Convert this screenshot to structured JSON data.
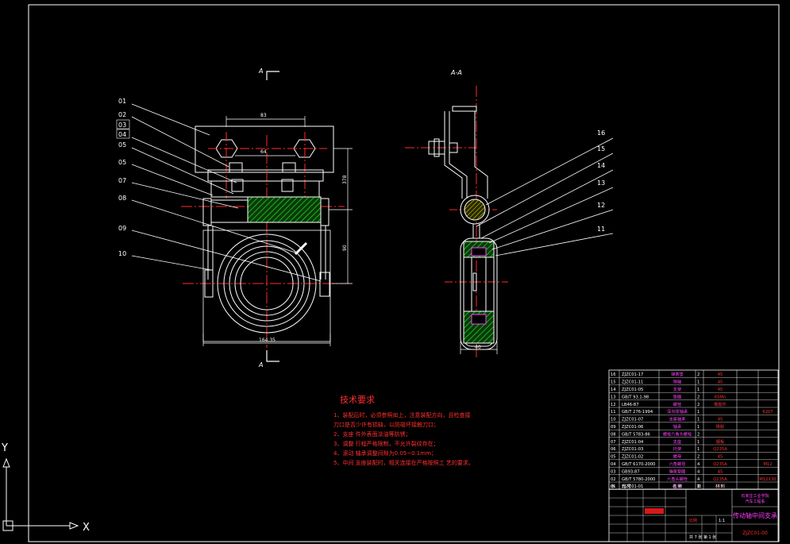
{
  "view_labels": {
    "section_marker_top": "A",
    "section_marker_bottom": "A",
    "section_view_title": "A-A"
  },
  "front_view": {
    "part_labels": [
      "01",
      "02",
      "03",
      "04",
      "05",
      "05",
      "07",
      "08",
      "09",
      "10"
    ],
    "dim_top": "83",
    "dim_inner": "64",
    "dim_height": "378",
    "dim_mid": "90",
    "dim_bottom": "164.35"
  },
  "side_view": {
    "part_labels": [
      "16",
      "15",
      "14",
      "13",
      "12",
      "11"
    ],
    "dim_width": "40"
  },
  "technical_requirements": {
    "title": "技术要求",
    "items": [
      "1、装配后时，必须参照如上，注意装配方向，且检查接",
      "刀口是否少许有损缺，以防碰坏接触刀口；",
      "2、支座 件外表面涂油等防锈；",
      "3、调整 行程严格限制，不允许裂纹存在；",
      "4、滚动 轴承调整间隙为0.05~0.1mm；",
      "5、中间 支座装配时，相关连接在严格按照工 艺的要求。"
    ]
  },
  "bom": {
    "rows": [
      {
        "no": "16",
        "code": "ZJZC01-17",
        "name": "弹簧垫",
        "qty": "2",
        "mat": "45",
        "note": ""
      },
      {
        "no": "15",
        "code": "ZJZC01-11",
        "name": "销轴",
        "qty": "1",
        "mat": "45",
        "note": ""
      },
      {
        "no": "14",
        "code": "ZJZC01-05",
        "name": "支架",
        "qty": "1",
        "mat": "45",
        "note": ""
      },
      {
        "no": "13",
        "code": "GB/T 93.1-98",
        "name": "垫圈",
        "qty": "2",
        "mat": "65Mn",
        "note": ""
      },
      {
        "no": "12",
        "code": "LB46-87",
        "name": "螺栓",
        "qty": "2",
        "mat": "橡胶件",
        "note": ""
      },
      {
        "no": "11",
        "code": "GB/T 276-1994",
        "name": "深沟球轴承",
        "qty": "1",
        "mat": "",
        "note": "6207"
      },
      {
        "no": "10",
        "code": "ZJZC01-07",
        "name": "支座轴承",
        "qty": "1",
        "mat": "45",
        "note": ""
      },
      {
        "no": "09",
        "code": "ZJZC01-06",
        "name": "轴承",
        "qty": "1",
        "mat": "橡胶",
        "note": ""
      },
      {
        "no": "08",
        "code": "GB/T 5783-86",
        "name": "螺栓六角头螺栓",
        "qty": "2",
        "mat": "",
        "note": ""
      },
      {
        "no": "07",
        "code": "ZJZC01-04",
        "name": "支座",
        "qty": "1",
        "mat": "钢板",
        "note": ""
      },
      {
        "no": "06",
        "code": "ZJZC01-03",
        "name": "托架",
        "qty": "1",
        "mat": "Q235A",
        "note": ""
      },
      {
        "no": "05",
        "code": "ZJZC01-02",
        "name": "螺母",
        "qty": "2",
        "mat": "45",
        "note": ""
      },
      {
        "no": "04",
        "code": "GB/T 6170-2000",
        "name": "六角螺母",
        "qty": "4",
        "mat": "Q235A",
        "note": "M12"
      },
      {
        "no": "03",
        "code": "GB93-87",
        "name": "弹簧垫圈",
        "qty": "4",
        "mat": "45",
        "note": ""
      },
      {
        "no": "02",
        "code": "GB/T 5780-2000",
        "name": "六角头螺栓",
        "qty": "4",
        "mat": "Q235A",
        "note": "M12X30"
      },
      {
        "no": "01",
        "code": "ZJZC01-01",
        "name": "支架",
        "qty": "1",
        "mat": "45",
        "note": ""
      }
    ],
    "header": {
      "no": "序",
      "code": "代 号",
      "name": "名 称",
      "qty": "数",
      "mat": "材 料",
      "note": ""
    }
  },
  "title_block": {
    "school": "石家庄工业学院",
    "dept": "汽车工程系",
    "drawing_name": "传动轴中间支承",
    "drawing_no": "ZJZC01-00",
    "sheet_info": "共 7 张  第 1 张",
    "scale_label": "比例",
    "scale": "1:1"
  },
  "ucs": {
    "x_label": "X",
    "y_label": "Y"
  },
  "colors": {
    "outline": "#ffffff",
    "center": "#ff2a2a",
    "dim": "#ffffff",
    "hatch": "#18c818",
    "yellow": "#e6e600",
    "cyan": "#40e0ff",
    "text_red": "#ff3030",
    "magenta": "#ff40ff"
  }
}
